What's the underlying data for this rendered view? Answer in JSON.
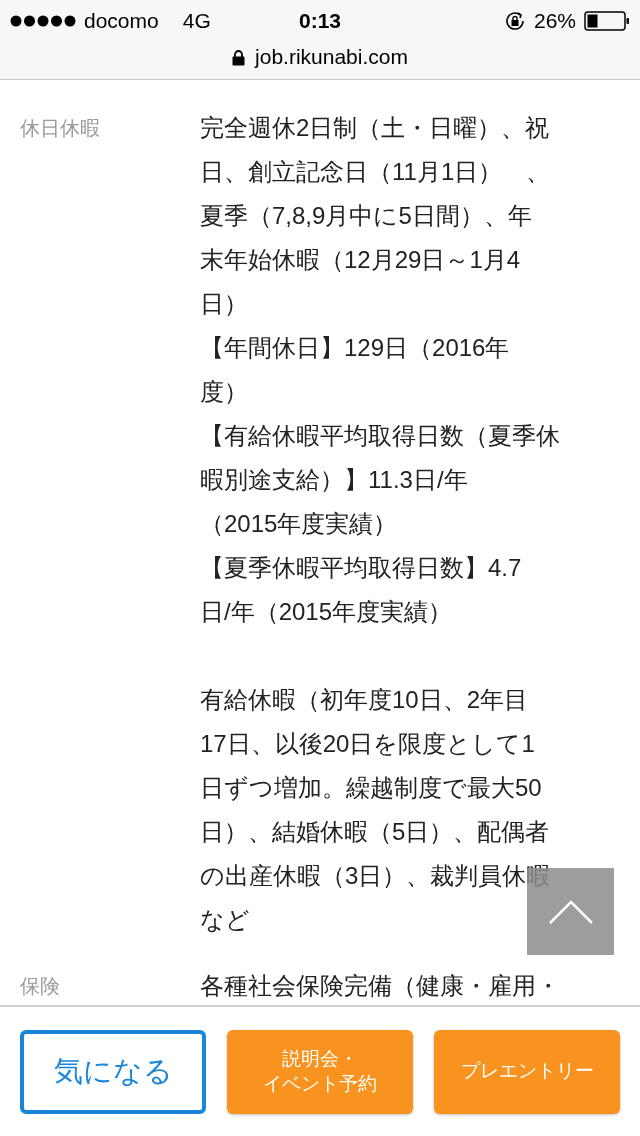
{
  "status_bar": {
    "carrier": "docomo",
    "network": "4G",
    "time": "0:13",
    "battery": "26%"
  },
  "url_bar": {
    "url": "job.rikunabi.com"
  },
  "details": [
    {
      "label": "休日休暇",
      "paragraphs": [
        [
          "完全週休2日制（土・日曜）、祝",
          "日、創立記念日（11月1日）　、",
          "夏季（7,8,9月中に5日間）、年",
          "末年始休暇（12月29日～1月4",
          "日）",
          "【年間休日】129日（2016年",
          "度）",
          "【有給休暇平均取得日数（夏季休",
          "暇別途支給）】11.3日/年",
          "（2015年度実績）",
          "【夏季休暇平均取得日数】4.7",
          "日/年（2015年度実績）"
        ],
        [
          "有給休暇（初年度10日、2年目",
          "17日、以後20日を限度として1",
          "日ずつ増加。繰越制度で最大50",
          "日）、結婚休暇（5日）、配偶者",
          "の出産休暇（3日）、裁判員休暇",
          "など"
        ]
      ]
    },
    {
      "label": "保険",
      "paragraphs": [
        [
          "各種社会保険完備（健康・雇用・"
        ]
      ]
    }
  ],
  "actions": [
    {
      "kind": "outline",
      "lines": [
        "気になる"
      ]
    },
    {
      "kind": "filled",
      "lines": [
        "説明会・",
        "イベント予約"
      ]
    },
    {
      "kind": "filled",
      "lines": [
        "プレエントリー"
      ]
    }
  ]
}
